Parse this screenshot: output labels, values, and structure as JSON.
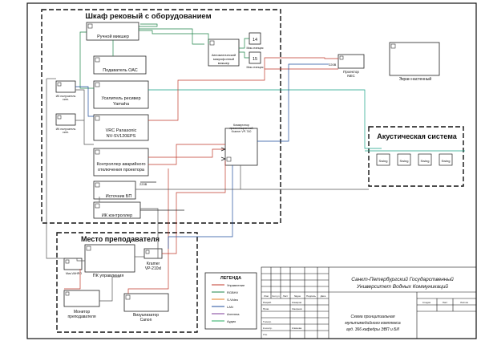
{
  "rack": {
    "title": "Шкаф рековый с оборудованием"
  },
  "teacher": {
    "title": "Место преподавателя"
  },
  "acoustic": {
    "title": "Акустическая система"
  },
  "devices": {
    "manual_mixer": "Ручной микшер",
    "auto_mixer": [
      "Автоматический",
      "микрофонный",
      "микшер"
    ],
    "mic_station": "Мик.станция",
    "mic_14": "14",
    "mic_15": "15",
    "feeder": "Подаватель ОАС",
    "amplifier": [
      "Усилитель ресивер",
      "Yamaha"
    ],
    "ir_receiver": [
      "ИК получатель",
      "сигн."
    ],
    "vrc": [
      "VRC Panasonic",
      "NV-SV120EPS"
    ],
    "emergency": [
      "Контроллер аварийного",
      "отключения проектора"
    ],
    "power": "Источник БП",
    "ir_controller": "ИК контроллер",
    "control_center": [
      "Коммутатор",
      "презентационной",
      "Kramer VP-740"
    ],
    "projector": [
      "Проектор",
      "NEC"
    ],
    "screen": "Экран настенный",
    "mic_wireless": "Мик.VAHRO",
    "pc": "ПК управления",
    "kramer": [
      "Kramer",
      "VP-210xl"
    ],
    "monitor": [
      "Монитор",
      "преподавателя"
    ],
    "visualizer": [
      "Визуализатор",
      "Canon"
    ],
    "swing": "Swing",
    "v220_a": "220В",
    "v220_b": "220В"
  },
  "legend": {
    "title": "ЛЕГЕНДА",
    "items": [
      {
        "label": "Управление",
        "color": "#c0392b"
      },
      {
        "label": "RGBHV",
        "color": "#1e8449"
      },
      {
        "label": "S-Video",
        "color": "#e67e22"
      },
      {
        "label": "LAN",
        "color": "#1f4e9c"
      },
      {
        "label": "Антенна",
        "color": "#7d3c98"
      },
      {
        "label": "Аудио",
        "color": "#27ae60"
      }
    ]
  },
  "titleblock": {
    "org": [
      "Санкт-Петербургский Государственный",
      "Университет Водных Коммуникаций"
    ],
    "doc": [
      "Схема принципиальная",
      "мультимедийного комплекса",
      "ауд. 366 кафедры ЭВП и БИ"
    ],
    "cols": [
      "Изм",
      "Кол.уч",
      "Лист",
      "№док",
      "Подпись",
      "Дата"
    ],
    "rows": [
      "Разраб.",
      "Пров.",
      "Т.контр.",
      "Н.контр.",
      "Утв."
    ],
    "names": [
      "Комаров",
      "Смирнов",
      "Климова"
    ],
    "stage_head": [
      "Стадия",
      "Лист",
      "Листов"
    ]
  }
}
